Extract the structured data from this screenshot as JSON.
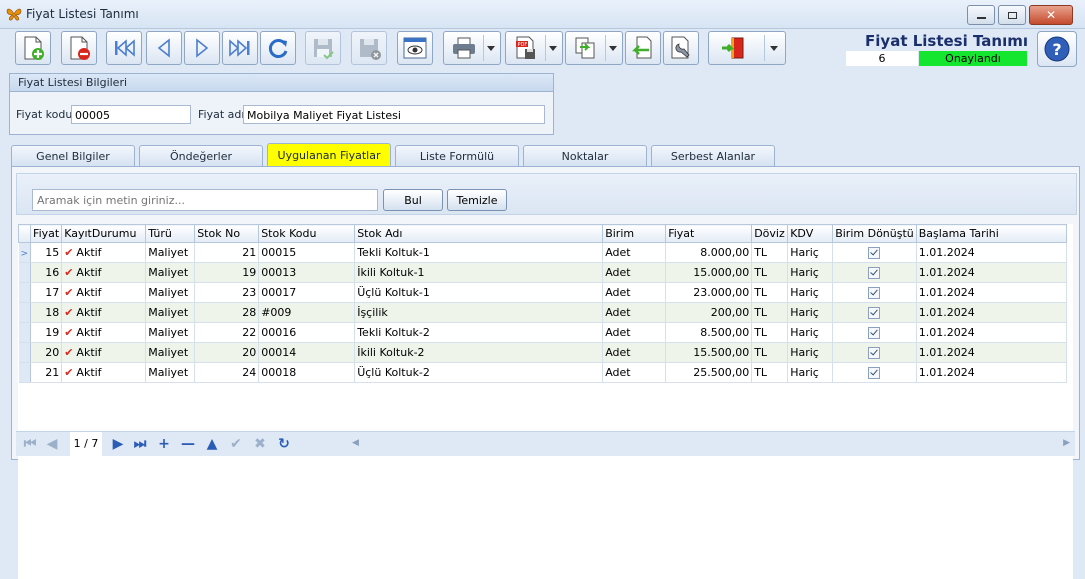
{
  "window": {
    "title": "Fiyat Listesi Tanımı"
  },
  "header": {
    "title": "Fiyat Listesi Tanımı",
    "record_no": "6",
    "status": "Onaylandı",
    "status_color": "#14e52f"
  },
  "group": {
    "title": "Fiyat Listesi Bilgileri",
    "code_label": "Fiyat kodu",
    "code_value": "00005",
    "name_label": "Fiyat adı",
    "name_value": "Mobilya Maliyet Fiyat Listesi"
  },
  "tabs": [
    {
      "label": "Genel Bilgiler"
    },
    {
      "label": "Öndeğerler"
    },
    {
      "label": "Uygulanan Fiyatlar",
      "active": true
    },
    {
      "label": "Liste Formülü"
    },
    {
      "label": "Noktalar"
    },
    {
      "label": "Serbest Alanlar"
    }
  ],
  "search": {
    "placeholder": "Aramak için metin giriniz...",
    "find_label": "Bul",
    "clear_label": "Temizle"
  },
  "grid": {
    "columns": [
      "Fiyat",
      "KayıtDurumu",
      "Türü",
      "Stok No",
      "Stok Kodu",
      "Stok Adı",
      "Birim",
      "Fiyat",
      "Döviz",
      "KDV",
      "Birim Dönüştü",
      "Başlama Tarihi"
    ],
    "rows": [
      {
        "fiyat_no": "15",
        "durum": "Aktif",
        "turu": "Maliyet",
        "stok_no": "21",
        "stok_kodu": "00015",
        "stok_adi": "Tekli Koltuk-1",
        "birim": "Adet",
        "fiyat": "8.000,00",
        "doviz": "TL",
        "kdv": "Hariç",
        "tarih": "1.01.2024"
      },
      {
        "fiyat_no": "16",
        "durum": "Aktif",
        "turu": "Maliyet",
        "stok_no": "19",
        "stok_kodu": "00013",
        "stok_adi": "İkili Koltuk-1",
        "birim": "Adet",
        "fiyat": "15.000,00",
        "doviz": "TL",
        "kdv": "Hariç",
        "tarih": "1.01.2024"
      },
      {
        "fiyat_no": "17",
        "durum": "Aktif",
        "turu": "Maliyet",
        "stok_no": "23",
        "stok_kodu": "00017",
        "stok_adi": "Üçlü Koltuk-1",
        "birim": "Adet",
        "fiyat": "23.000,00",
        "doviz": "TL",
        "kdv": "Hariç",
        "tarih": "1.01.2024"
      },
      {
        "fiyat_no": "18",
        "durum": "Aktif",
        "turu": "Maliyet",
        "stok_no": "28",
        "stok_kodu": "#009",
        "stok_adi": "İşçilik",
        "birim": "Adet",
        "fiyat": "200,00",
        "doviz": "TL",
        "kdv": "Hariç",
        "tarih": "1.01.2024"
      },
      {
        "fiyat_no": "19",
        "durum": "Aktif",
        "turu": "Maliyet",
        "stok_no": "22",
        "stok_kodu": "00016",
        "stok_adi": "Tekli Koltuk-2",
        "birim": "Adet",
        "fiyat": "8.500,00",
        "doviz": "TL",
        "kdv": "Hariç",
        "tarih": "1.01.2024"
      },
      {
        "fiyat_no": "20",
        "durum": "Aktif",
        "turu": "Maliyet",
        "stok_no": "20",
        "stok_kodu": "00014",
        "stok_adi": "İkili Koltuk-2",
        "birim": "Adet",
        "fiyat": "15.500,00",
        "doviz": "TL",
        "kdv": "Hariç",
        "tarih": "1.01.2024"
      },
      {
        "fiyat_no": "21",
        "durum": "Aktif",
        "turu": "Maliyet",
        "stok_no": "24",
        "stok_kodu": "00018",
        "stok_adi": "Üçlü Koltuk-2",
        "birim": "Adet",
        "fiyat": "25.500,00",
        "doviz": "TL",
        "kdv": "Hariç",
        "tarih": "1.01.2024"
      }
    ]
  },
  "navigator": {
    "page_info": "1 / 7"
  }
}
